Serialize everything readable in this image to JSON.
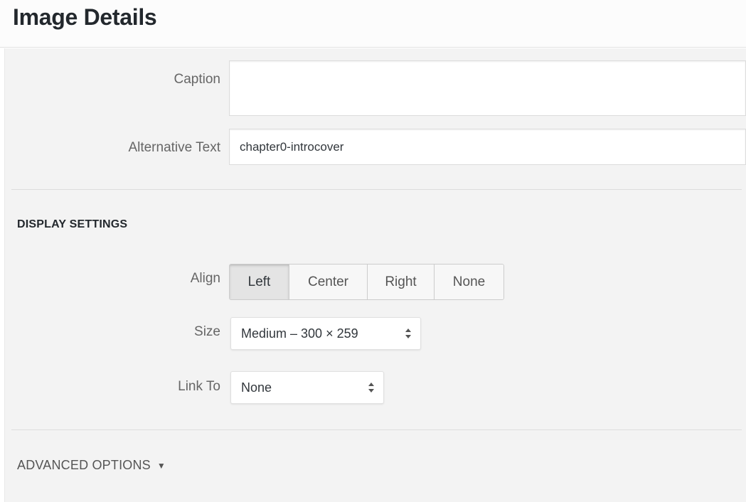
{
  "header": {
    "title": "Image Details"
  },
  "fields": {
    "caption": {
      "label": "Caption",
      "value": ""
    },
    "alt_text": {
      "label": "Alternative Text",
      "value": "chapter0-introcover"
    }
  },
  "display_settings": {
    "title": "DISPLAY SETTINGS",
    "align": {
      "label": "Align",
      "options": [
        "Left",
        "Center",
        "Right",
        "None"
      ],
      "selected": "Left"
    },
    "size": {
      "label": "Size",
      "value": "Medium – 300 × 259"
    },
    "link_to": {
      "label": "Link To",
      "value": "None"
    }
  },
  "advanced": {
    "label": "ADVANCED OPTIONS",
    "icon": "triangle-down-icon"
  }
}
